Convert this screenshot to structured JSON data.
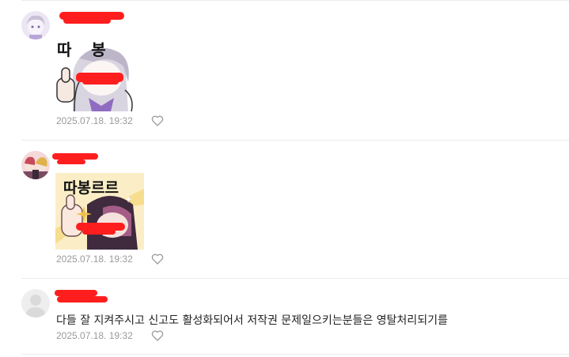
{
  "comments": [
    {
      "sticker_text": "따   봉",
      "timestamp": "2025.07.18. 19:32",
      "like_icon": "heart-outline-icon"
    },
    {
      "sticker_text": "따봉르르",
      "timestamp": "2025.07.18. 19:32",
      "like_icon": "heart-outline-icon"
    },
    {
      "text": "다들 잘 지켜주시고 신고도 활성화되어서 저작권 문제일으키는분들은 영탈처리되기를",
      "timestamp": "2025.07.18. 19:32",
      "like_icon": "heart-outline-icon"
    }
  ],
  "colors": {
    "redaction": "#ff1e1e",
    "timestamp": "#9a9a9a",
    "divider": "#ececec"
  }
}
